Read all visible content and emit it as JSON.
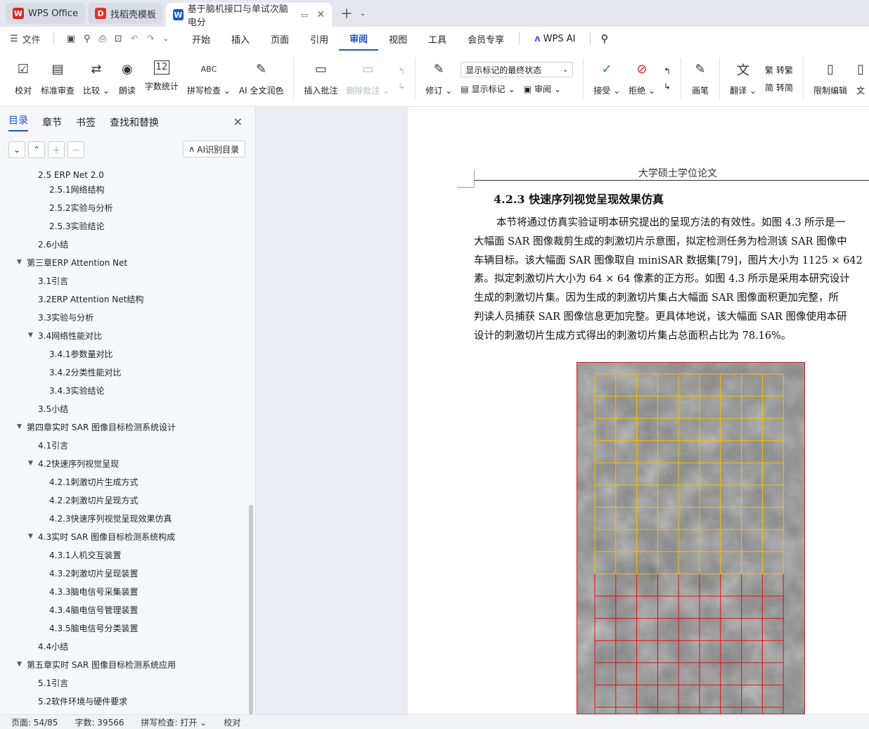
{
  "tabs": [
    {
      "label": "WPS Office",
      "logo": "W",
      "logo_color": "#d7261e"
    },
    {
      "label": "找稻壳模板",
      "logo": "D",
      "logo_color": "#e0322b"
    },
    {
      "label": "基于脑机接口与单试次脑电分",
      "logo": "W",
      "logo_color": "#1a56d6"
    }
  ],
  "menu": {
    "file": "文件",
    "items": [
      "开始",
      "插入",
      "页面",
      "引用",
      "审阅",
      "视图",
      "工具",
      "会员专享"
    ],
    "active": "审阅",
    "wps_ai": "WPS AI"
  },
  "ribbon": {
    "proofread": "校对",
    "std_review": "标准审查",
    "compare": "比较",
    "read_aloud": "朗读",
    "word_count": "字数统计",
    "spell_check": "拼写检查",
    "ai_polish": "AI 全文润色",
    "insert_comment": "插入批注",
    "delete_comment": "删除批注",
    "track_changes": "修订",
    "markup_dropdown": "显示标记的最终状态",
    "show_markup": "显示标记",
    "review": "审阅",
    "accept": "接受",
    "reject": "拒绝",
    "ink": "画笔",
    "translate": "翻译",
    "to_traditional": "转繁",
    "to_simplified": "转简",
    "restrict_edit": "限制编辑",
    "doc_more": "文"
  },
  "nav": {
    "tabs": [
      "目录",
      "章节",
      "书签",
      "查找和替换"
    ],
    "ai_toc": "AI识别目录",
    "toc": [
      {
        "text": "2.5 ERP Net 2.0",
        "level": 2,
        "arrow": "",
        "partial": true
      },
      {
        "text": "2.5.1网络结构",
        "level": 3,
        "arrow": ""
      },
      {
        "text": "2.5.2实验与分析",
        "level": 3,
        "arrow": ""
      },
      {
        "text": "2.5.3实验结论",
        "level": 3,
        "arrow": ""
      },
      {
        "text": "2.6小结",
        "level": 2,
        "arrow": ""
      },
      {
        "text": "第三章ERP Attention Net",
        "level": 1,
        "arrow": "▼"
      },
      {
        "text": "3.1引言",
        "level": 2,
        "arrow": ""
      },
      {
        "text": "3.2ERP Attention Net结构",
        "level": 2,
        "arrow": ""
      },
      {
        "text": "3.3实验与分析",
        "level": 2,
        "arrow": ""
      },
      {
        "text": "3.4网络性能对比",
        "level": 2,
        "arrow": "▼"
      },
      {
        "text": "3.4.1参数量对比",
        "level": 3,
        "arrow": ""
      },
      {
        "text": "3.4.2分类性能对比",
        "level": 3,
        "arrow": ""
      },
      {
        "text": "3.4.3实验结论",
        "level": 3,
        "arrow": ""
      },
      {
        "text": "3.5小结",
        "level": 2,
        "arrow": ""
      },
      {
        "text": "第四章实时 SAR 图像目标检测系统设计",
        "level": 1,
        "arrow": "▼"
      },
      {
        "text": "4.1引言",
        "level": 2,
        "arrow": ""
      },
      {
        "text": "4.2快速序列视觉呈现",
        "level": 2,
        "arrow": "▼"
      },
      {
        "text": "4.2.1刺激切片生成方式",
        "level": 3,
        "arrow": ""
      },
      {
        "text": "4.2.2刺激切片呈现方式",
        "level": 3,
        "arrow": ""
      },
      {
        "text": "4.2.3快速序列视觉呈现效果仿真",
        "level": 3,
        "arrow": ""
      },
      {
        "text": "4.3实时 SAR 图像目标检测系统构成",
        "level": 2,
        "arrow": "▼"
      },
      {
        "text": "4.3.1人机交互装置",
        "level": 3,
        "arrow": ""
      },
      {
        "text": "4.3.2刺激切片呈现装置",
        "level": 3,
        "arrow": ""
      },
      {
        "text": "4.3.3脑电信号采集装置",
        "level": 3,
        "arrow": ""
      },
      {
        "text": "4.3.4脑电信号管理装置",
        "level": 3,
        "arrow": ""
      },
      {
        "text": "4.3.5脑电信号分类装置",
        "level": 3,
        "arrow": ""
      },
      {
        "text": "4.4小结",
        "level": 2,
        "arrow": ""
      },
      {
        "text": "第五章实时 SAR 图像目标检测系统应用",
        "level": 1,
        "arrow": "▼"
      },
      {
        "text": "5.1引言",
        "level": 2,
        "arrow": ""
      },
      {
        "text": "5.2软件环境与硬件要求",
        "level": 2,
        "arrow": ""
      }
    ]
  },
  "doc": {
    "header": "大学硕士学位论文",
    "heading": "4.2.3   快速序列视觉呈现效果仿真",
    "lines": [
      "本节将通过仿真实验证明本研究提出的呈现方法的有效性。如图 4.3 所示是一",
      "大幅面 SAR 图像裁剪生成的刺激切片示意图，拟定检测任务为检测该 SAR 图像中",
      "车辆目标。该大幅面 SAR 图像取自 miniSAR 数据集[79]，图片大小为 1125 × 642",
      "素。拟定刺激切片大小为 64 × 64 像素的正方形。如图 4.3 所示是采用本研究设计",
      "生成的刺激切片集。因为生成的刺激切片集占大幅面 SAR 图像面积更加完整，所",
      "判读人员捕获 SAR 图像信息更加完整。更具体地说，该大幅面 SAR 图像使用本研",
      "设计的刺激切片生成方式得出的刺激切片集占总面积占比为 78.16%。"
    ]
  },
  "status": {
    "page": "页面: 54/85",
    "words": "字数: 39566",
    "spell": "拼写检查: 打开",
    "proof": "校对"
  },
  "colors": {
    "accent": "#1a56d6",
    "grid_yellow": "#f0c400",
    "grid_red": "#e01010"
  }
}
